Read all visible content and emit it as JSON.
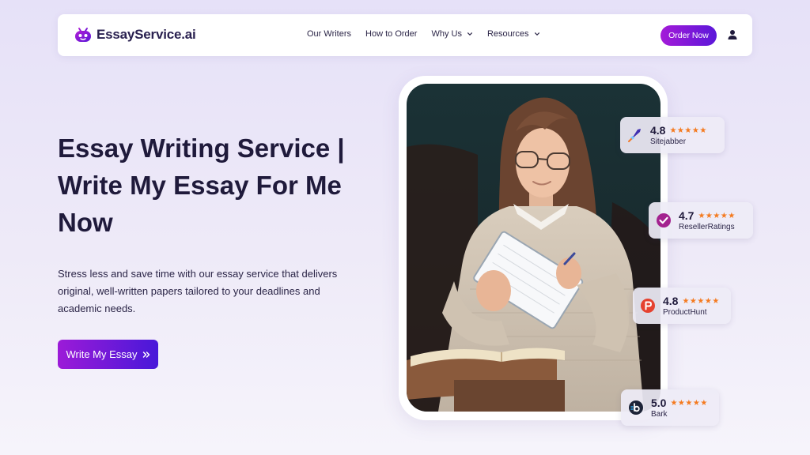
{
  "header": {
    "brand": "EssayService.ai",
    "nav": [
      {
        "label": "Our Writers"
      },
      {
        "label": "How to Order"
      },
      {
        "label": "Why Us"
      },
      {
        "label": "Resources"
      }
    ],
    "order_button": "Order Now"
  },
  "hero": {
    "title_lines": [
      "Essay Writing Service |",
      "Write My Essay For Me",
      "Now"
    ],
    "description_lines": [
      "Stress less and save time with our essay service that delivers",
      "original, well-written papers tailored to your deadlines and",
      "academic needs."
    ],
    "cta": "Write My Essay"
  },
  "ratings": [
    {
      "score": "4.8",
      "stars": "★★★★★",
      "name": "Sitejabber",
      "icon": "sitejabber-icon"
    },
    {
      "score": "4.7",
      "stars": "★★★★★",
      "name": "ResellerRatings",
      "icon": "resellerratings-icon"
    },
    {
      "score": "4.8",
      "stars": "★★★★★",
      "name": "ProductHunt",
      "icon": "producthunt-icon"
    },
    {
      "score": "5.0",
      "stars": "★★★★★",
      "name": "Bark",
      "icon": "bark-icon"
    }
  ],
  "colors": {
    "brand_gradient_start": "#a41bd8",
    "brand_gradient_end": "#5b17d9",
    "star": "#f47a1f",
    "text_dark": "#1f1a3b"
  }
}
